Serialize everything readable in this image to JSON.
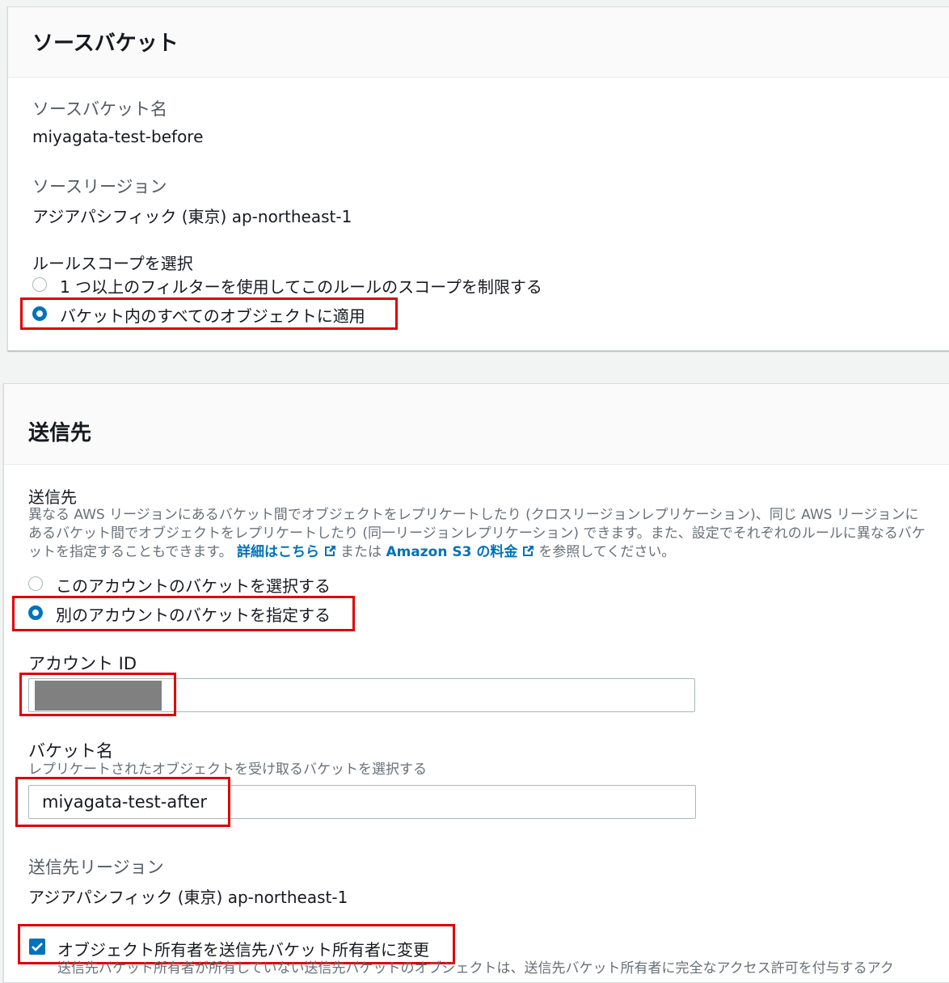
{
  "source": {
    "title": "ソースバケット",
    "bucket_name_label": "ソースバケット名",
    "bucket_name_value": "miyagata-test-before",
    "region_label": "ソースリージョン",
    "region_value": "アジアパシフィック (東京) ap-northeast-1",
    "scope_label": "ルールスコープを選択",
    "scope_options": [
      {
        "label": "1 つ以上のフィルターを使用してこのルールのスコープを制限する",
        "selected": false
      },
      {
        "label": "バケット内のすべてのオブジェクトに適用",
        "selected": true
      }
    ]
  },
  "destination": {
    "title": "送信先",
    "section_label": "送信先",
    "description_pre": "異なる AWS リージョンにあるバケット間でオブジェクトをレプリケートしたり (クロスリージョンレプリケーション)、同じ AWS リージョンにあるバケット間でオブジェクトをレプリケートしたり (同一リージョンレプリケーション) できます。また、設定でそれぞれのルールに異なるバケットを指定することもできます。",
    "link_details": "詳細はこちら",
    "description_mid": "または",
    "link_pricing": "Amazon S3 の料金",
    "description_post": "を参照してください。",
    "options": [
      {
        "label": "このアカウントのバケットを選択する",
        "selected": false
      },
      {
        "label": "別のアカウントのバケットを指定する",
        "selected": true
      }
    ],
    "account_id_label": "アカウント ID",
    "bucket_name_label": "バケット名",
    "bucket_name_hint": "レプリケートされたオブジェクトを受け取るバケットを選択する",
    "bucket_name_value": "miyagata-test-after",
    "region_label": "送信先リージョン",
    "region_value": "アジアパシフィック (東京) ap-northeast-1",
    "owner_change_label": "オブジェクト所有者を送信先バケット所有者に変更",
    "owner_change_checked": true,
    "owner_change_desc": "送信先バケット所有者が所有していない送信先バケットのオブジェクトは、送信先バケット所有者に完全なアクセス許可を付与するアク"
  },
  "colors": {
    "accent": "#0073bb",
    "highlight": "#e00000",
    "link": "#0073bb"
  },
  "icons": [
    "external-link-icon",
    "checkmark-icon"
  ]
}
